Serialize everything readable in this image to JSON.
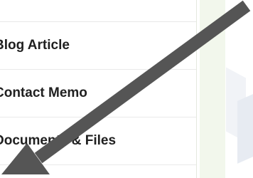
{
  "menu": {
    "items": [
      {
        "label": "Blog Article"
      },
      {
        "label": "Contact Memo"
      },
      {
        "label": "Documents & Files"
      }
    ]
  },
  "colors": {
    "background": "#ffffff",
    "side_strip": "#f2f7ec",
    "arrow": "#555555",
    "text": "#202020",
    "divider": "#e9e9e9",
    "watermark": "#e7ebf2"
  },
  "icons": {
    "arrow": "arrow-down-left-icon"
  }
}
